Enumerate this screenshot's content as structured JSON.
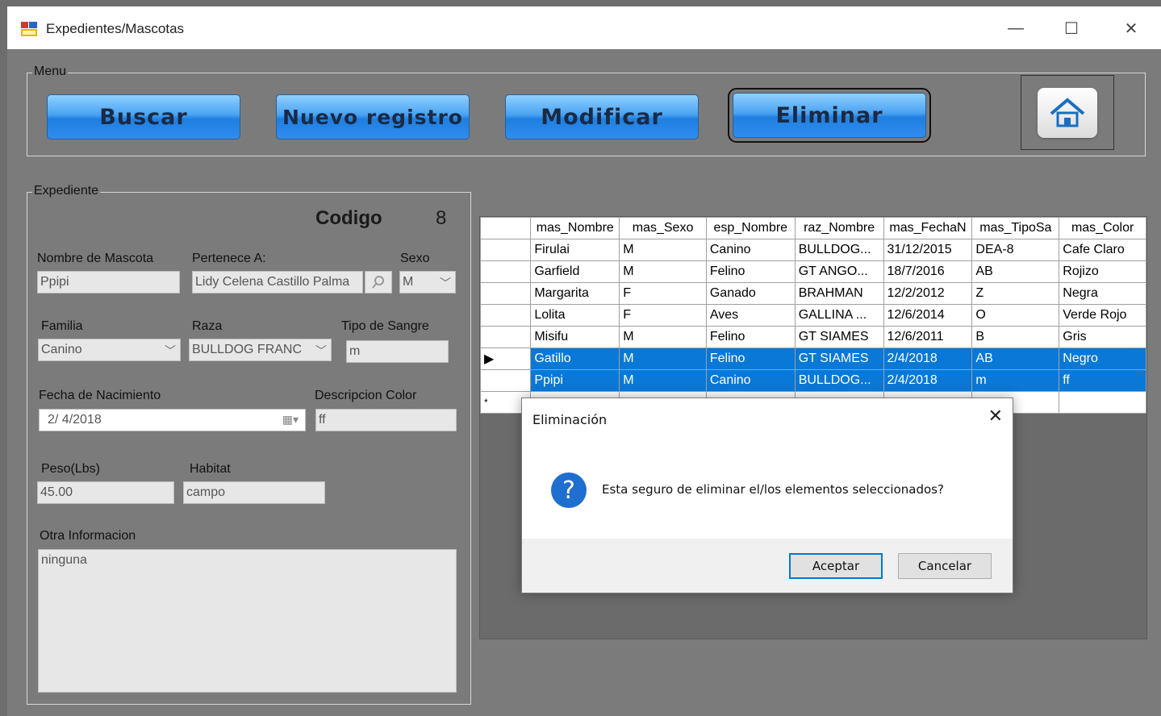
{
  "window": {
    "title": "Expedientes/Mascotas",
    "minimize_glyph": "—",
    "maximize_glyph": "☐",
    "close_glyph": "✕"
  },
  "menu": {
    "legend": "Menu",
    "buscar": "Buscar",
    "nuevo": "Nuevo registro",
    "modificar": "Modificar",
    "eliminar": "Eliminar",
    "home_icon": "home-icon"
  },
  "expediente": {
    "legend": "Expediente",
    "codigo_label": "Codigo",
    "codigo_value": "8",
    "nombre_label": "Nombre de Mascota",
    "nombre_value": "Ppipi",
    "pertenece_label": "Pertenece A:",
    "pertenece_value": "Lidy Celena Castillo Palma",
    "sexo_label": "Sexo",
    "sexo_value": "M",
    "familia_label": "Familia",
    "familia_value": "Canino",
    "raza_label": "Raza",
    "raza_value": "BULLDOG FRANC",
    "sangre_label": "Tipo de Sangre",
    "sangre_value": "m",
    "fecha_label": "Fecha de Nacimiento",
    "fecha_value": "2/ 4/2018",
    "color_label": "Descripcion Color",
    "color_value": "ff",
    "peso_label": "Peso(Lbs)",
    "peso_value": "45.00",
    "habitat_label": "Habitat",
    "habitat_value": "campo",
    "otra_label": "Otra Informacion",
    "otra_value": "ninguna"
  },
  "grid": {
    "columns": [
      "mas_Nombre",
      "mas_Sexo",
      "esp_Nombre",
      "raz_Nombre",
      "mas_FechaN",
      "mas_TipoSa",
      "mas_Color"
    ],
    "rows": [
      [
        "Firulai",
        "M",
        "Canino",
        "BULLDOG...",
        "31/12/2015",
        "DEA-8",
        "Cafe Claro"
      ],
      [
        "Garfield",
        "M",
        "Felino",
        "GT ANGO...",
        "18/7/2016",
        "AB",
        "Rojizo"
      ],
      [
        "Margarita",
        "F",
        "Ganado",
        "BRAHMAN",
        "12/2/2012",
        "Z",
        "Negra"
      ],
      [
        "Lolita",
        "F",
        "Aves",
        "GALLINA ...",
        "12/6/2014",
        "O",
        "Verde Rojo"
      ],
      [
        "Misifu",
        "M",
        "Felino",
        "GT SIAMES",
        "12/6/2011",
        "B",
        "Gris"
      ],
      [
        "Gatillo",
        "M",
        "Felino",
        "GT SIAMES",
        "2/4/2018",
        "AB",
        "Negro"
      ],
      [
        "Ppipi",
        "M",
        "Canino",
        "BULLDOG...",
        "2/4/2018",
        "m",
        "ff"
      ]
    ],
    "current_row_glyph": "▶",
    "new_row_glyph": "*"
  },
  "dialog": {
    "title": "Eliminación",
    "message": "Esta seguro de eliminar el/los elementos seleccionados?",
    "ok": "Aceptar",
    "cancel": "Cancelar",
    "icon": "question-icon"
  }
}
